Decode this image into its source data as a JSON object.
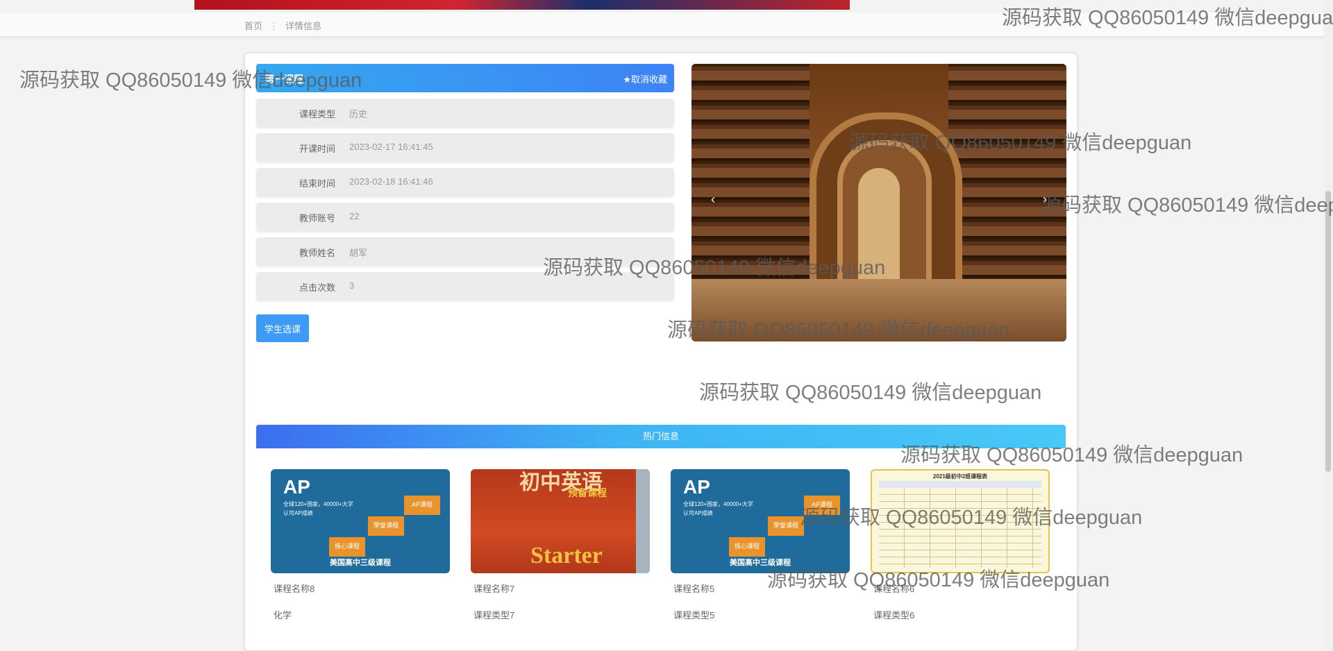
{
  "breadcrumb": {
    "home": "首页",
    "separator": "⋮",
    "current": "详情信息"
  },
  "course": {
    "title": "第一课程",
    "favorite_label": "★取消收藏",
    "fields": [
      {
        "label": "课程类型",
        "value": "历史"
      },
      {
        "label": "开课时间",
        "value": "2023-02-17 16:41:45"
      },
      {
        "label": "结束时间",
        "value": "2023-02-18 16:41:46"
      },
      {
        "label": "教师账号",
        "value": "22"
      },
      {
        "label": "教师姓名",
        "value": "胡军"
      },
      {
        "label": "点击次数",
        "value": "3"
      }
    ],
    "select_button": "学生选课"
  },
  "carousel": {
    "prev_icon": "‹",
    "next_icon": "›"
  },
  "hot": {
    "title": "热门信息",
    "items": [
      {
        "name": "课程名称8",
        "type": "化学",
        "thumb": {
          "ap": "AP",
          "sub1": "全球120+国家，40000+大学",
          "sub2": "认可AP成绩",
          "b1": "AP课程",
          "b2": "荣誉课程",
          "b3": "核心课程",
          "foot": "美国高中三级课程"
        }
      },
      {
        "name": "课程名称7",
        "type": "课程类型7",
        "thumb": {
          "t1": "初中英语",
          "t2": "预备课程",
          "t3": "Starter"
        }
      },
      {
        "name": "课程名称5",
        "type": "课程类型5",
        "thumb": {
          "ap": "AP",
          "sub1": "全球120+国家，40000+大学",
          "sub2": "认可AP成绩",
          "b1": "AP课程",
          "b2": "荣誉课程",
          "b3": "核心课程",
          "foot": "美国高中三级课程"
        }
      },
      {
        "name": "课程名称6",
        "type": "课程类型6",
        "thumb": {
          "title": "2021级初中2班课程表"
        }
      }
    ]
  },
  "watermark_text": "源码获取 QQ86050149 微信deepguan"
}
